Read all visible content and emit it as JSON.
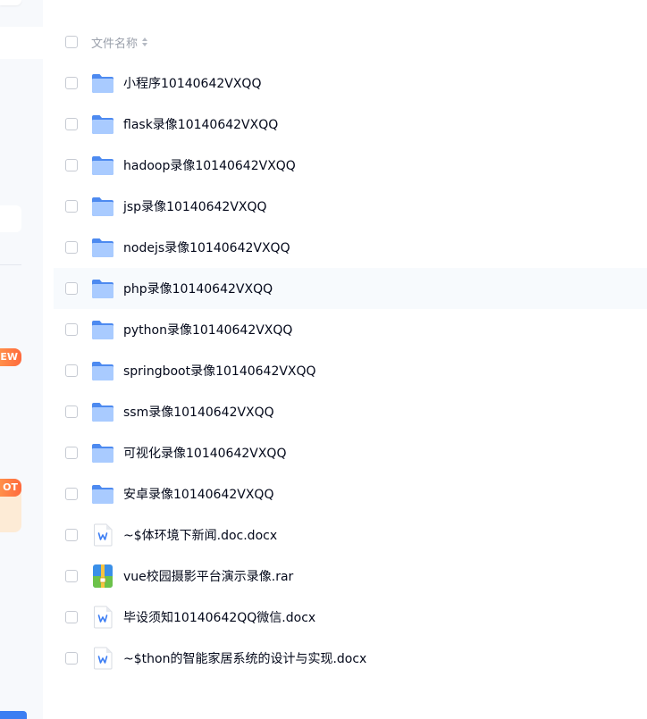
{
  "sidebar": {
    "badge_new": "EW",
    "badge_hot": "OT"
  },
  "list": {
    "header": {
      "name_label": "文件名称"
    },
    "rows": [
      {
        "name": "小程序10140642VXQQ",
        "type": "folder"
      },
      {
        "name": "flask录像10140642VXQQ",
        "type": "folder"
      },
      {
        "name": "hadoop录像10140642VXQQ",
        "type": "folder"
      },
      {
        "name": "jsp录像10140642VXQQ",
        "type": "folder"
      },
      {
        "name": "nodejs录像10140642VXQQ",
        "type": "folder"
      },
      {
        "name": "php录像10140642VXQQ",
        "type": "folder",
        "hover": true
      },
      {
        "name": "python录像10140642VXQQ",
        "type": "folder"
      },
      {
        "name": "springboot录像10140642VXQQ",
        "type": "folder"
      },
      {
        "name": "ssm录像10140642VXQQ",
        "type": "folder"
      },
      {
        "name": "可视化录像10140642VXQQ",
        "type": "folder"
      },
      {
        "name": "安卓录像10140642VXQQ",
        "type": "folder"
      },
      {
        "name": "~$体环境下新闻.doc.docx",
        "type": "word-doc"
      },
      {
        "name": "vue校园摄影平台演示录像.rar",
        "type": "rar-archive"
      },
      {
        "name": "毕设须知10140642QQ微信.docx",
        "type": "word-doc"
      },
      {
        "name": "~$thon的智能家居系统的设计与实现.docx",
        "type": "word-doc"
      }
    ]
  },
  "colors": {
    "folder_back": "#4d8af0",
    "folder_front": "#a9cbff",
    "word_accent": "#3d7ef4",
    "rar_blue": "#3a8fe8",
    "rar_green": "#6cc24a",
    "rar_yellow": "#f7c340"
  }
}
